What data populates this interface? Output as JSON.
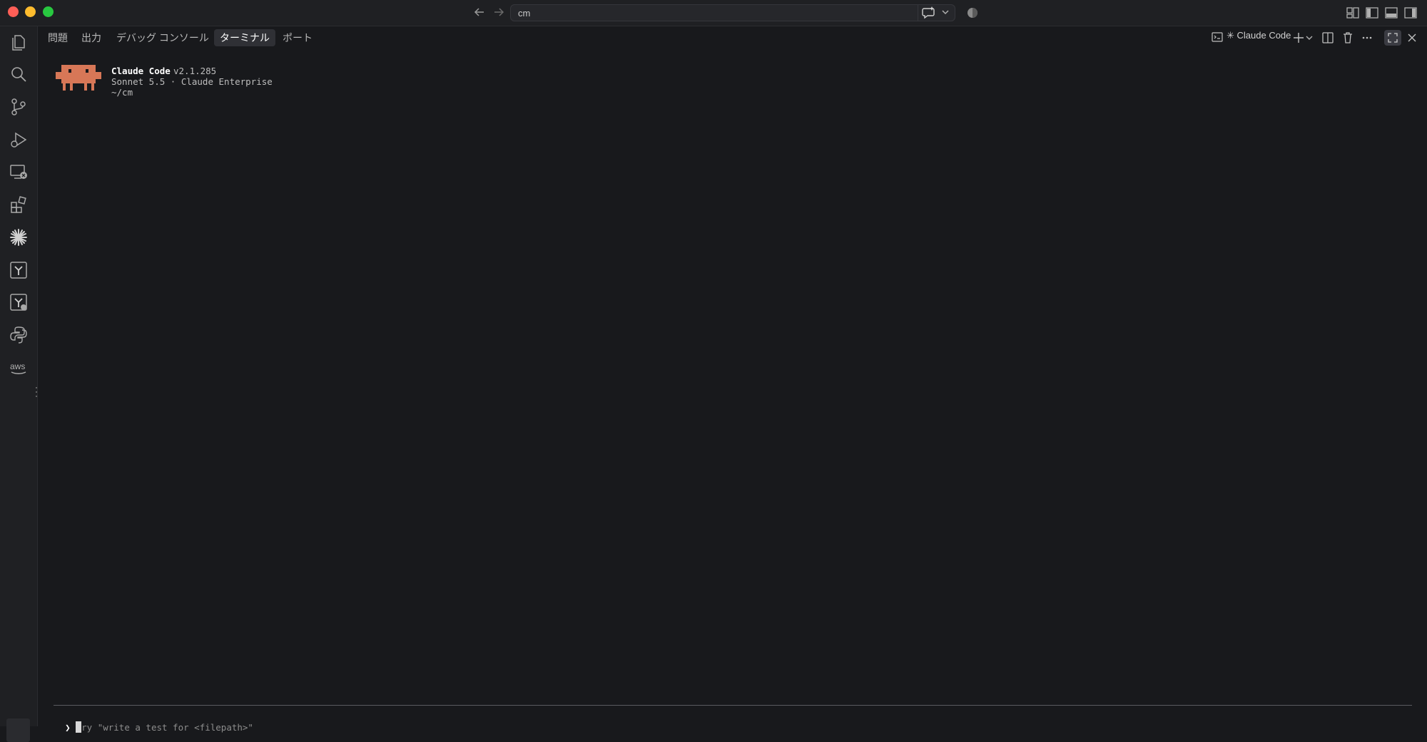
{
  "window": {
    "command_center": "cm"
  },
  "panel": {
    "tabs": [
      {
        "label": "問題"
      },
      {
        "label": "出力"
      },
      {
        "label": "デバッグ コンソール"
      },
      {
        "label": "ターミナル",
        "active": true
      },
      {
        "label": "ポート"
      }
    ],
    "terminal_name": "✳ Claude Code"
  },
  "terminal": {
    "app_name": "Claude Code",
    "version": "v2.1.285",
    "model_line": "Sonnet 5.5 · Claude Enterprise",
    "cwd": "~/cm",
    "prompt_symbol": "❯",
    "input_placeholder": "ry \"write a test for <filepath>\""
  },
  "activity_bar": [
    "explorer-icon",
    "search-icon",
    "source-control-icon",
    "run-debug-icon",
    "remote-explorer-icon",
    "extensions-icon",
    "claude-icon",
    "tree-icon",
    "tree-alt-icon",
    "python-icon",
    "aws-icon"
  ],
  "colors": {
    "background": "#18191c",
    "claude_logo": "#d77757",
    "active_tab": "#2f3035"
  }
}
